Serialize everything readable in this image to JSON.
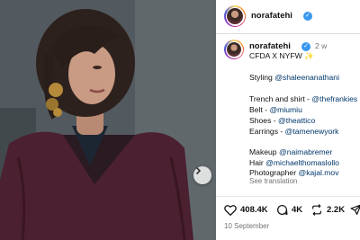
{
  "post": {
    "username": "norafatehi",
    "time": "2 w",
    "caption_title": "CFDA X NYFW ✨",
    "styling_label": "Styling",
    "styling_handle": "@shaleenanathani",
    "trench_label": "Trench and shirt -",
    "trench_handle": "@thefrankies",
    "belt_label": "Belt -",
    "belt_handle": "@miumiu",
    "shoes_label": "Shoes -",
    "shoes_handle": "@theattico",
    "earrings_label": "Earrings -",
    "earrings_handle": "@tamenewyork",
    "makeup_label": "Makeup",
    "makeup_handle": "@naimabremer",
    "hair_label": "Hair",
    "hair_handle": "@michaelthomaslollo",
    "photographer_label": "Photographer",
    "photographer_handle": "@kajal.mov",
    "see_translation": "See translation"
  },
  "actions": {
    "likes": "408.4K",
    "comments": "4K",
    "reposts": "2.2K"
  },
  "date": "10 September",
  "colors": {
    "mention": "#00376b",
    "verified": "#3897f0",
    "muted": "#737373"
  },
  "icons": [
    "chevron-right-icon",
    "verified-badge-icon",
    "heart-icon",
    "comment-icon",
    "repost-icon",
    "share-icon"
  ]
}
